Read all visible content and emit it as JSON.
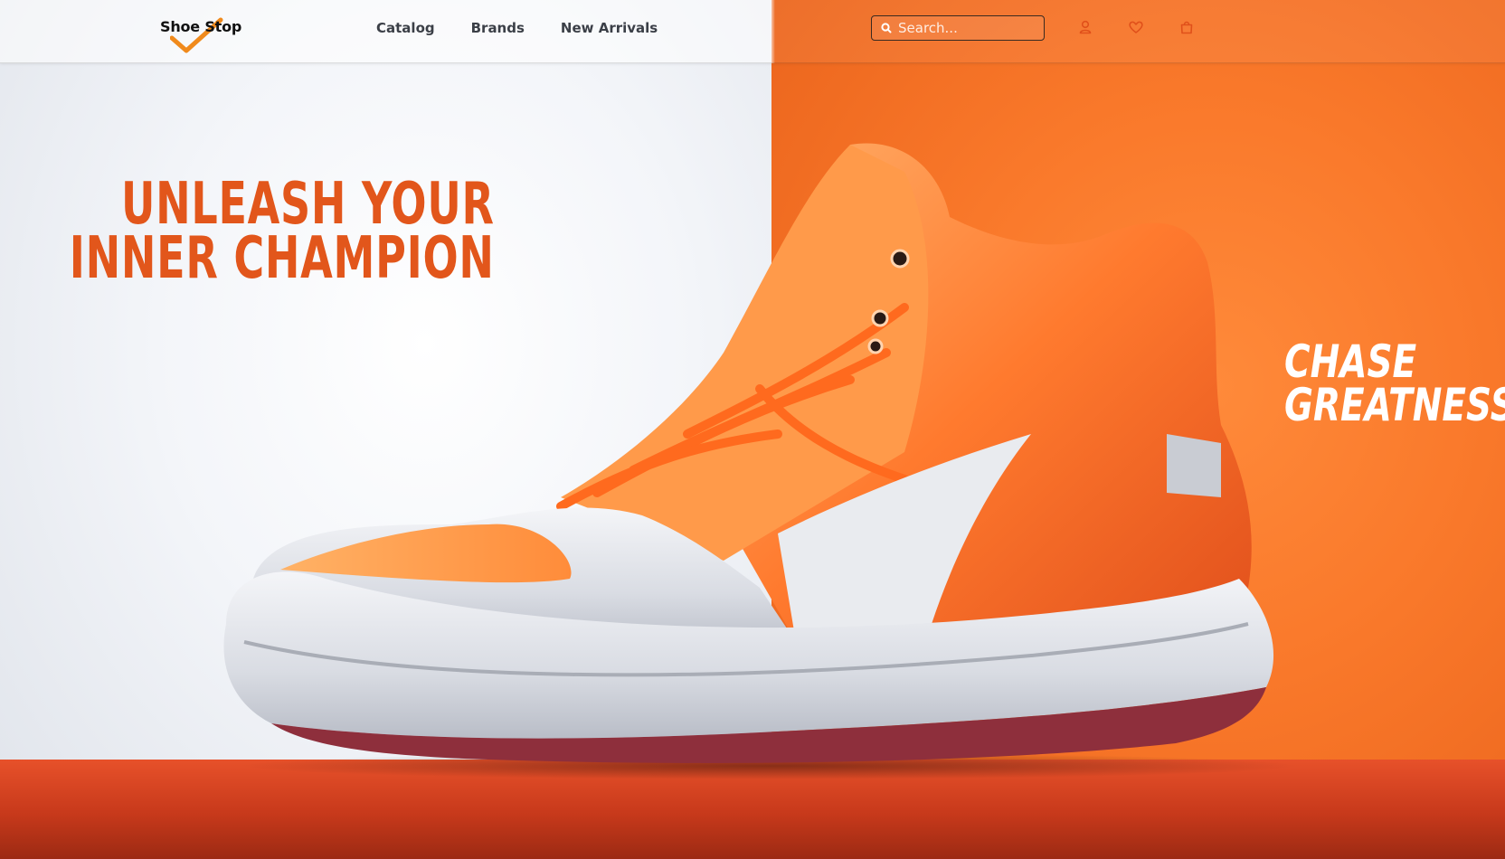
{
  "brand": {
    "name": "Shoe Stop"
  },
  "nav": {
    "items": [
      {
        "label": "Catalog"
      },
      {
        "label": "Brands"
      },
      {
        "label": "New Arrivals"
      }
    ]
  },
  "search": {
    "placeholder": "Search..."
  },
  "header_icons": [
    "user-icon",
    "heart-icon",
    "shopping-bag-icon"
  ],
  "hero": {
    "headline_lines": [
      "UNLEASH YOUR",
      "INNER CHAMPION"
    ],
    "tagline_lines": [
      "CHASE",
      "GREATNESS"
    ],
    "image": "orange-white-high-top-sneaker"
  },
  "colors": {
    "accent": "#e2561b",
    "orange_panel": "#f9782a",
    "floor": "#c7391b",
    "logo_check": "#f08a1c"
  }
}
